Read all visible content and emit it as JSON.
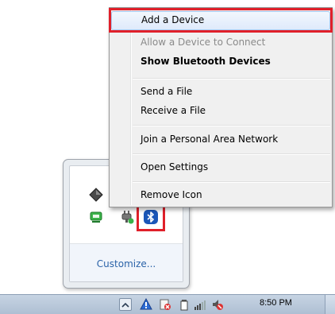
{
  "context_menu": {
    "items": [
      {
        "label": "Add a Device",
        "state": "highlighted"
      },
      {
        "label": "Allow a Device to Connect",
        "state": "disabled"
      },
      {
        "label": "Show Bluetooth Devices",
        "state": "default"
      },
      {
        "label": "Send a File",
        "state": "normal"
      },
      {
        "label": "Receive a File",
        "state": "normal"
      },
      {
        "label": "Join a Personal Area Network",
        "state": "normal"
      },
      {
        "label": "Open Settings",
        "state": "normal"
      },
      {
        "label": "Remove Icon",
        "state": "normal"
      }
    ]
  },
  "tray_overflow": {
    "icons": [
      "diamond-icon",
      "network-adapter-icon",
      "power-plug-icon",
      "bluetooth-icon"
    ],
    "customize_label": "Customize..."
  },
  "taskbar": {
    "clock": "8:50 PM",
    "icons": [
      "show-hidden-icons-chevron",
      "action-center-flag-icon",
      "media-icon",
      "battery-icon",
      "signal-bars-icon",
      "volume-muted-icon"
    ]
  },
  "colors": {
    "highlight_box": "#e0202a",
    "bluetooth_badge": "#1a56b8",
    "link": "#2b63a8"
  }
}
